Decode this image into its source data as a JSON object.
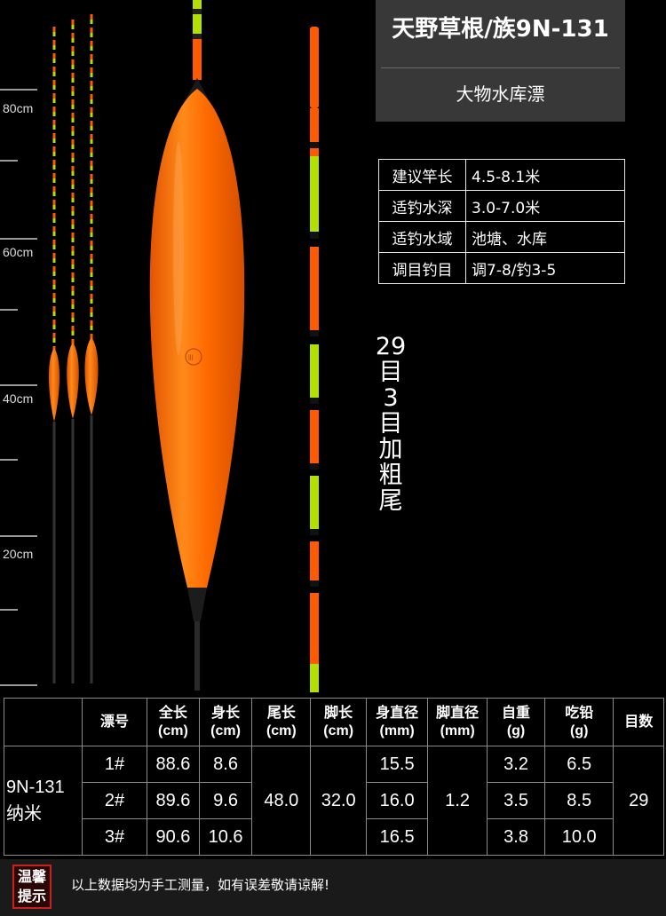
{
  "ruler": {
    "labels": [
      "80cm",
      "60cm",
      "40cm",
      "20cm"
    ]
  },
  "header": {
    "title": "天野草根/族9N-131",
    "subtitle": "大物水库漂"
  },
  "specs": [
    {
      "key": "建议竿长",
      "value": "4.5-8.1米"
    },
    {
      "key": "适钓水深",
      "value": "3.0-7.0米"
    },
    {
      "key": "适钓水域",
      "value": "池塘、水库"
    },
    {
      "key": "调目钓目",
      "value": "调7-8/钓3-5"
    }
  ],
  "tail_note": [
    "29",
    "目",
    "3",
    "目",
    "加",
    "粗",
    "尾"
  ],
  "table": {
    "headers": [
      {
        "l1": "漂号",
        "l2": ""
      },
      {
        "l1": "全长",
        "l2": "(cm)"
      },
      {
        "l1": "身长",
        "l2": "(cm)"
      },
      {
        "l1": "尾长",
        "l2": "(cm)"
      },
      {
        "l1": "脚长",
        "l2": "(cm)"
      },
      {
        "l1": "身直径",
        "l2": "(mm)"
      },
      {
        "l1": "脚直径",
        "l2": "(mm)"
      },
      {
        "l1": "自重",
        "l2": "(g)"
      },
      {
        "l1": "吃铅",
        "l2": "(g)"
      },
      {
        "l1": "目数",
        "l2": ""
      }
    ],
    "model_line1": "9N-131",
    "model_line2": "纳米",
    "rows": [
      {
        "no": "1#",
        "total": "88.6",
        "body": "8.6",
        "diameter": "15.5",
        "weight": "3.2",
        "lead": "6.5"
      },
      {
        "no": "2#",
        "total": "89.6",
        "body": "9.6",
        "diameter": "16.0",
        "weight": "3.5",
        "lead": "8.5"
      },
      {
        "no": "3#",
        "total": "90.6",
        "body": "10.6",
        "diameter": "16.5",
        "weight": "3.8",
        "lead": "10.0"
      }
    ],
    "tail_len": "48.0",
    "foot_len": "32.0",
    "foot_dia": "1.2",
    "marks": "29"
  },
  "note": {
    "badge_l1": "温馨",
    "badge_l2": "提示",
    "text": "以上数据均为手工测量，如有误差敬请谅解!"
  },
  "colors": {
    "orange": "#ff6a00",
    "fluoro_green": "#c6ff00",
    "background": "#000000",
    "panel": "#383838",
    "badge_red": "#c8201e"
  }
}
